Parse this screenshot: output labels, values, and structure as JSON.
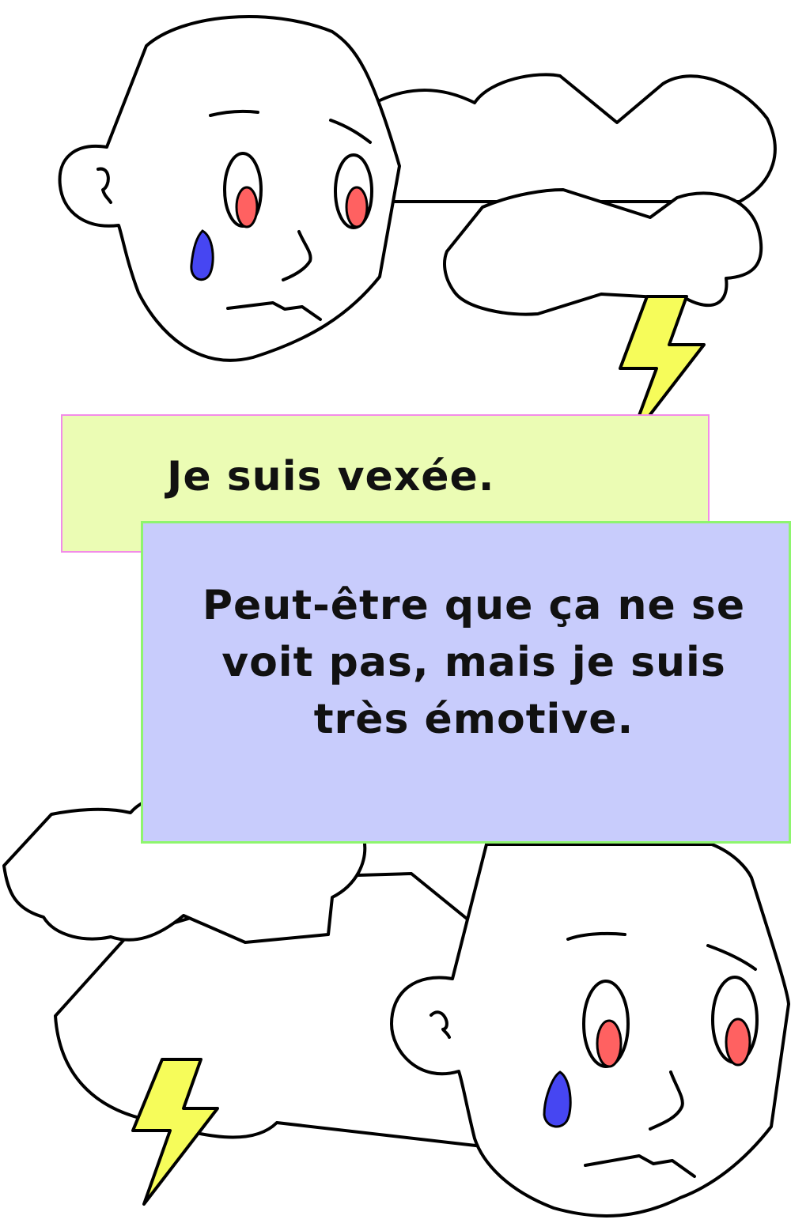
{
  "bubble_top": {
    "text": "Je suis vexée."
  },
  "bubble_bottom": {
    "text": "Peut-être que ça ne se voit pas, mais je suis très émotive."
  },
  "colors": {
    "top_box_fill": "#ebfcb4",
    "top_box_border": "#f28ce8",
    "bottom_box_fill": "#c8ccfc",
    "bottom_box_border": "#8ef56e",
    "pupil": "#ff6161",
    "tear": "#4646f2",
    "lightning": "#f6fc5a"
  },
  "icons": [
    "sad-face",
    "storm-cloud",
    "lightning-bolt",
    "tear-drop"
  ]
}
